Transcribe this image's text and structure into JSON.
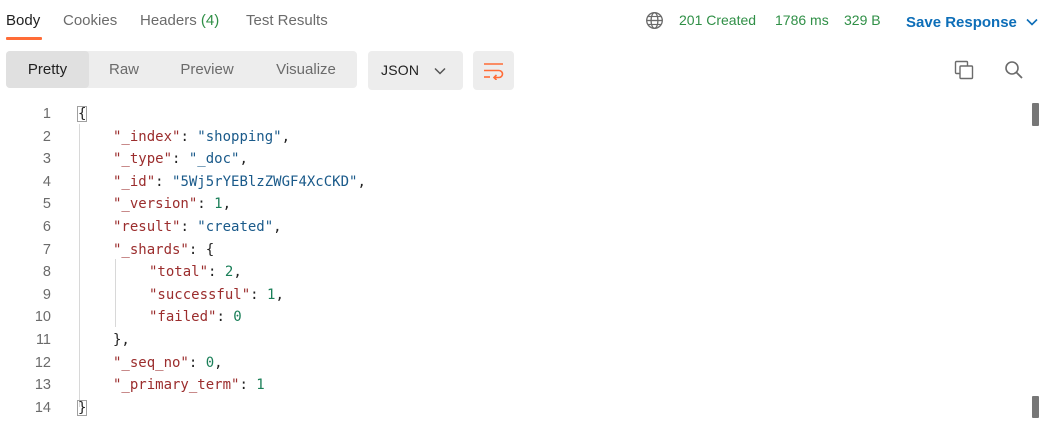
{
  "tabs": [
    {
      "label": "Body",
      "active": true
    },
    {
      "label": "Cookies"
    },
    {
      "label": "Headers",
      "count": "(4)"
    },
    {
      "label": "Test Results"
    }
  ],
  "status": {
    "code": "201 Created",
    "time": "1786 ms",
    "size": "329 B"
  },
  "save_response": {
    "label": "Save Response"
  },
  "view_modes": [
    "Pretty",
    "Raw",
    "Preview",
    "Visualize"
  ],
  "active_view_mode": "Pretty",
  "format": {
    "selected": "JSON"
  },
  "icons": {
    "globe": "globe-icon",
    "wrap": "wrap-lines-icon",
    "copy": "copy-icon",
    "search": "search-icon",
    "chevron": "chevron-down-icon"
  },
  "colors": {
    "accent": "#ff6c37",
    "success": "#2f8f46",
    "link": "#0d6eb8",
    "json_key": "#9b2d2d",
    "json_string": "#1a5a8a",
    "json_number": "#1a7f58"
  },
  "code": {
    "line_numbers": [
      "1",
      "2",
      "3",
      "4",
      "5",
      "6",
      "7",
      "8",
      "9",
      "10",
      "11",
      "12",
      "13",
      "14"
    ],
    "lines": [
      {
        "text": "{"
      },
      {
        "key": "\"_index\"",
        "value": "\"shopping\"",
        "value_type": "string",
        "trail": ","
      },
      {
        "key": "\"_type\"",
        "value": "\"_doc\"",
        "value_type": "string",
        "trail": ","
      },
      {
        "key": "\"_id\"",
        "value": "\"5Wj5rYEBlzZWGF4XcCKD\"",
        "value_type": "string",
        "trail": ","
      },
      {
        "key": "\"_version\"",
        "value": "1",
        "value_type": "number",
        "trail": ","
      },
      {
        "key": "\"result\"",
        "value": "\"created\"",
        "value_type": "string",
        "trail": ","
      },
      {
        "key": "\"_shards\"",
        "value": "{",
        "value_type": "punct",
        "trail": ""
      },
      {
        "key": "\"total\"",
        "value": "2",
        "value_type": "number",
        "trail": ","
      },
      {
        "key": "\"successful\"",
        "value": "1",
        "value_type": "number",
        "trail": ","
      },
      {
        "key": "\"failed\"",
        "value": "0",
        "value_type": "number",
        "trail": ""
      },
      {
        "text": "},"
      },
      {
        "key": "\"_seq_no\"",
        "value": "0",
        "value_type": "number",
        "trail": ","
      },
      {
        "key": "\"_primary_term\"",
        "value": "1",
        "value_type": "number",
        "trail": ""
      },
      {
        "text": "}"
      }
    ]
  }
}
